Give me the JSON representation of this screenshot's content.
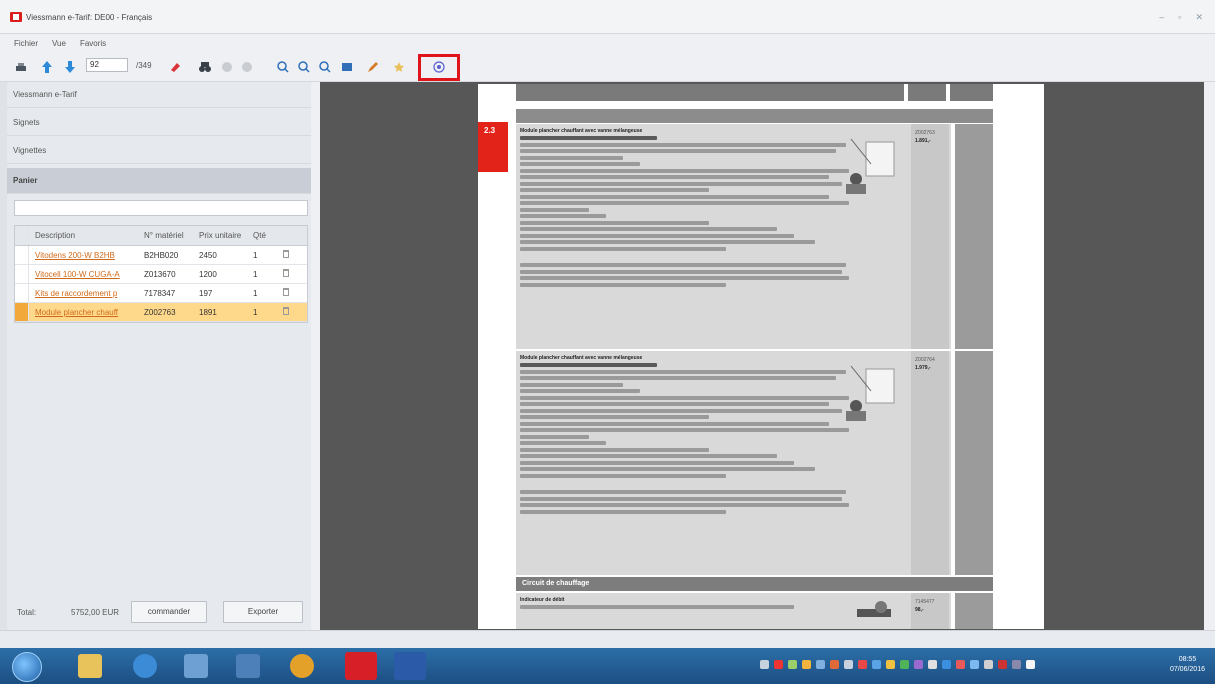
{
  "window": {
    "title": "Viessmann e-Tarif: DE00 - Français",
    "controls": [
      "–",
      "▫",
      "✕"
    ]
  },
  "menu": [
    "Fichier",
    "Vue",
    "Favoris"
  ],
  "toolbar": {
    "page_value": "92",
    "page_total": "/349"
  },
  "sidebar": {
    "sections": [
      "Viessmann e-Tarif",
      "Signets",
      "Vignettes",
      "Panier"
    ],
    "grid": {
      "headers": [
        "Description",
        "N° matériel",
        "Prix unitaire",
        "Qté"
      ],
      "rows": [
        {
          "description": "Vitodens 200-W B2HB",
          "material": "B2HB020",
          "price": "2450",
          "qty": "1"
        },
        {
          "description": "Vitocell 100-W CUGA-A",
          "material": "Z013670",
          "price": "1200",
          "qty": "1"
        },
        {
          "description": "Kits de raccordement p",
          "material": "7178347",
          "price": "197",
          "qty": "1"
        },
        {
          "description": "Module plancher chauff",
          "material": "Z002763",
          "price": "1891",
          "qty": "1"
        }
      ]
    },
    "footer": {
      "total_label": "Total:",
      "total_value": "5752,00 EUR",
      "order_button": "commander",
      "export_button": "Exporter"
    }
  },
  "document": {
    "chapter": "2.3",
    "block1": {
      "title": "Module plancher chauffant avec vanne mélangeuse",
      "ref": "Z002763",
      "price": "1.891,-"
    },
    "block2": {
      "title": "Module plancher chauffant avec vanne mélangeuse",
      "ref": "Z002764",
      "price": "1.979,-"
    },
    "section_title": "Circuit de chauffage",
    "block3": {
      "title": "Indicateur de débit",
      "ref": "7145477",
      "price": "98,-"
    }
  },
  "taskbar": {
    "time": "08:55",
    "date": "07/06/2016"
  }
}
